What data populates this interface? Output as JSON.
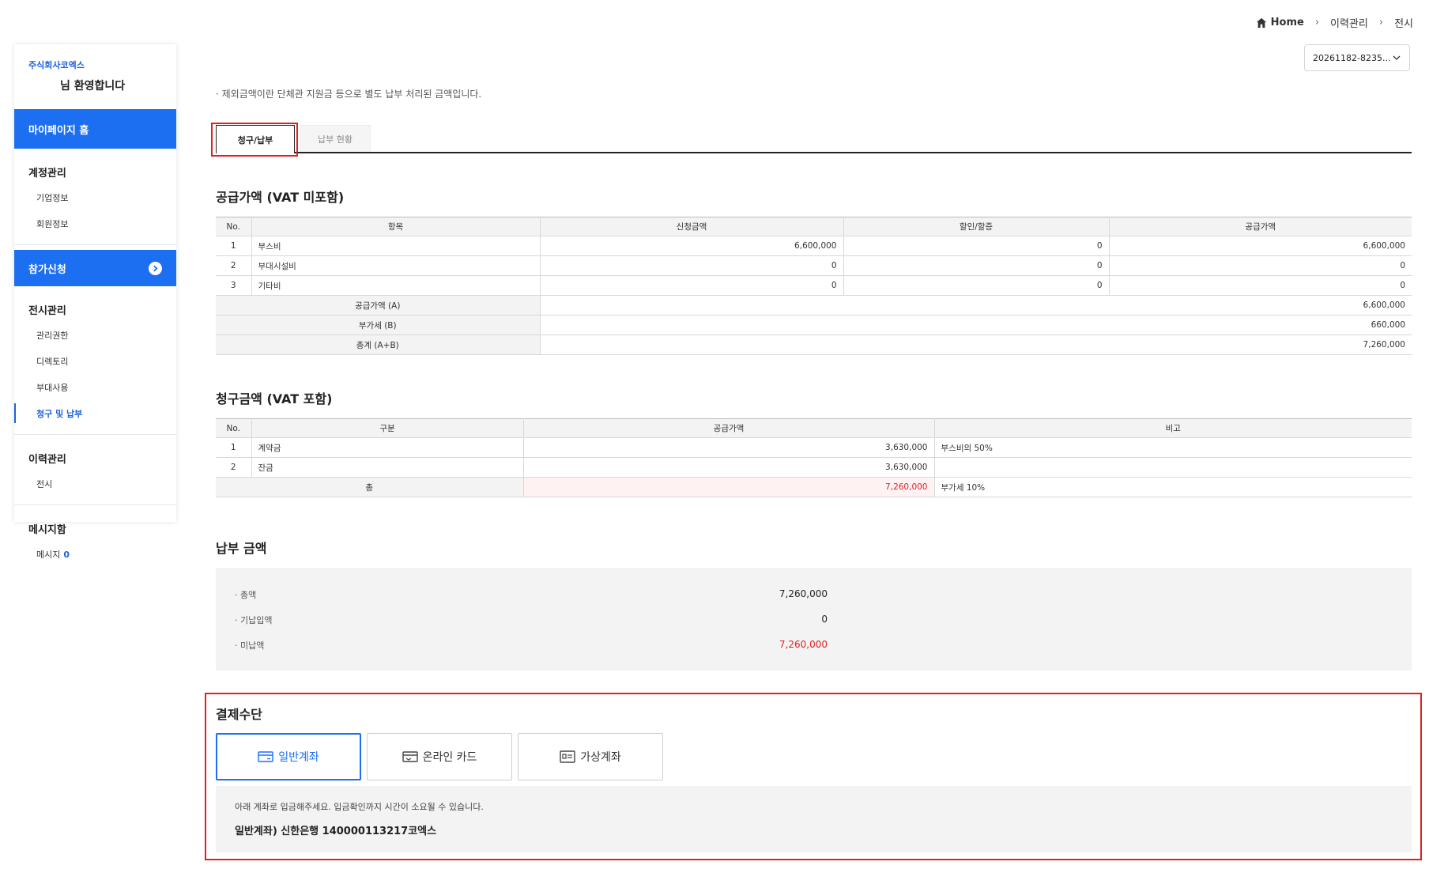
{
  "breadcrumb": {
    "home": "Home",
    "level1": "이력관리",
    "level2": "전시"
  },
  "period_select": {
    "value": "20261182-8235..."
  },
  "sidebar": {
    "company": "주식회사코엑스",
    "welcome": "님 환영합니다",
    "home": "마이페이지 홈",
    "account_group": {
      "title": "계정관리",
      "items": [
        "기업정보",
        "회원정보"
      ]
    },
    "apply": "참가신청",
    "exhibit_group": {
      "title": "전시관리",
      "items": [
        "관리권한",
        "디렉토리",
        "부대사용",
        "청구 및 납부"
      ]
    },
    "history_group": {
      "title": "이력관리",
      "items": [
        "전시"
      ]
    },
    "message_group": {
      "title": "메시지함",
      "item": "메시지",
      "count": "0"
    }
  },
  "notice": "· 제외금액이란 단체관 지원금 등으로 별도 납부 처리된 금액입니다.",
  "tabs": [
    "청구/납부",
    "납부 현황"
  ],
  "supply": {
    "title": "공급가액 (VAT 미포함)",
    "headers": [
      "No.",
      "항목",
      "신청금액",
      "할인/할증",
      "공급가액"
    ],
    "rows": [
      {
        "no": "1",
        "item": "부스비",
        "request": "6,600,000",
        "discount": "0",
        "supply": "6,600,000"
      },
      {
        "no": "2",
        "item": "부대시설비",
        "request": "0",
        "discount": "0",
        "supply": "0"
      },
      {
        "no": "3",
        "item": "기타비",
        "request": "0",
        "discount": "0",
        "supply": "0"
      }
    ],
    "summary": [
      {
        "label": "공급가액 (A)",
        "value": "6,600,000"
      },
      {
        "label": "부가세 (B)",
        "value": "660,000"
      },
      {
        "label": "총계 (A+B)",
        "value": "7,260,000"
      }
    ]
  },
  "billing": {
    "title": "청구금액 (VAT 포함)",
    "headers": [
      "No.",
      "구분",
      "공급가액",
      "비고"
    ],
    "rows": [
      {
        "no": "1",
        "type": "계약금",
        "amount": "3,630,000",
        "note": "부스비의 50%"
      },
      {
        "no": "2",
        "type": "잔금",
        "amount": "3,630,000",
        "note": ""
      }
    ],
    "total": {
      "label": "총",
      "amount": "7,260,000",
      "note": "부가세 10%"
    }
  },
  "payment_amount": {
    "title": "납부 금액",
    "rows": [
      {
        "label": "· 총액",
        "value": "7,260,000"
      },
      {
        "label": "· 기납입액",
        "value": "0"
      },
      {
        "label": "· 미납액",
        "value": "7,260,000"
      }
    ]
  },
  "payment_method": {
    "title": "결제수단",
    "options": [
      "일반계좌",
      "온라인 카드",
      "가상계좌"
    ],
    "selected": "일반계좌",
    "note": "아래 계좌로 입금해주세요. 입금확인까지 시간이 소요될 수 있습니다.",
    "account": "일반계좌) 신한은행 140000113217코엑스"
  },
  "colors": {
    "accent": "#1d6ff2",
    "alert": "#e02020"
  }
}
